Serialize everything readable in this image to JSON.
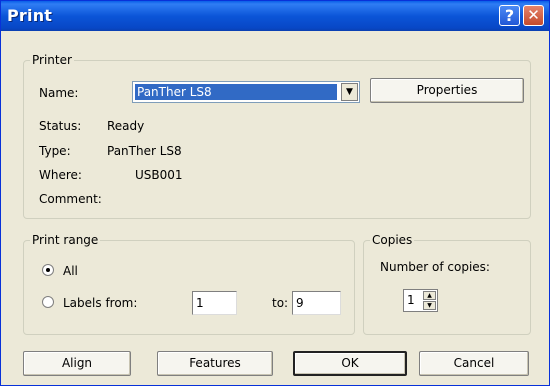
{
  "dialog": {
    "title": "Print",
    "help_icon": "?",
    "close_icon": "✕"
  },
  "printer": {
    "legend": "Printer",
    "name_label": "Name:",
    "name_value": "PanTher LS8",
    "properties_button": "Properties",
    "status_label": "Status:",
    "status_value": "Ready",
    "type_label": "Type:",
    "type_value": "PanTher LS8",
    "where_label": "Where:",
    "where_value": "USB001",
    "comment_label": "Comment:",
    "comment_value": ""
  },
  "print_range": {
    "legend": "Print range",
    "all_label": "All",
    "all_selected": true,
    "labels_from_label": "Labels from:",
    "from_value": "1",
    "to_label": "to:",
    "to_value": "9"
  },
  "copies": {
    "legend": "Copies",
    "number_label": "Number of copies:",
    "value": "1"
  },
  "buttons": {
    "align": "Align",
    "features": "Features",
    "ok": "OK",
    "cancel": "Cancel"
  }
}
